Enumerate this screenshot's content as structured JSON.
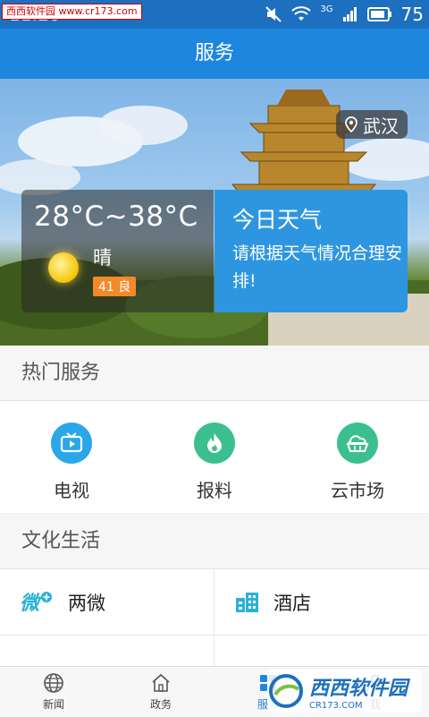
{
  "status_bar": {
    "time": "11:20",
    "network": "3G",
    "battery": "75"
  },
  "watermark_top": "西西软件园 www.cr173.com",
  "appbar": {
    "title": "服务"
  },
  "banner": {
    "location": "武汉",
    "weather": {
      "temp_range": "28°C~38°C",
      "condition": "晴",
      "aqi": "41 良"
    },
    "today": {
      "title": "今日天气",
      "tip": "请根据天气情况合理安排!"
    }
  },
  "hot_services": {
    "title": "热门服务",
    "items": [
      {
        "label": "电视",
        "icon": "tv-icon",
        "color": "#2aa7e8"
      },
      {
        "label": "报料",
        "icon": "flame-icon",
        "color": "#3cbf8f"
      },
      {
        "label": "云市场",
        "icon": "cloud-market-icon",
        "color": "#3cbf8f"
      }
    ]
  },
  "culture": {
    "title": "文化生活",
    "items": [
      {
        "label": "两微",
        "icon": "weibo-icon"
      },
      {
        "label": "酒店",
        "icon": "hotel-icon"
      }
    ]
  },
  "tabs": [
    {
      "label": "新闻",
      "icon": "globe-icon"
    },
    {
      "label": "政务",
      "icon": "home-icon"
    },
    {
      "label": "服务",
      "icon": "service-icon",
      "active": true
    },
    {
      "label": "我",
      "icon": "user-icon"
    }
  ],
  "watermark_bottom": {
    "text": "西西软件园",
    "url": "CR173.COM"
  }
}
